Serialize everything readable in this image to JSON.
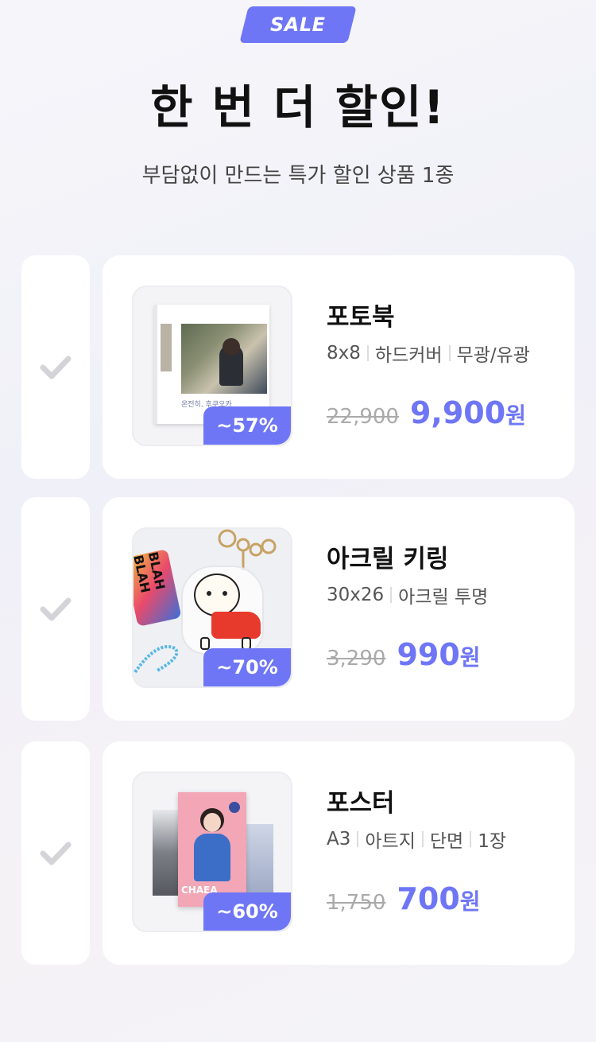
{
  "badge": "SALE",
  "headline": "한 번 더 할인!",
  "subline": "부담없이 만드는 특가 할인 상품 1종",
  "products": [
    {
      "name": "포토북",
      "specs": [
        "8x8",
        "하드커버",
        "무광/유광"
      ],
      "discount": "~57%",
      "original_price": "22,900",
      "sale_price": "9,900",
      "currency": "원",
      "thumb_caption": "온전히, 후쿠오카"
    },
    {
      "name": "아크릴 키링",
      "specs": [
        "30x26",
        "아크릴 투명"
      ],
      "discount": "~70%",
      "original_price": "3,290",
      "sale_price": "990",
      "currency": "원",
      "thumb_text": "BLAH BLAH"
    },
    {
      "name": "포스터",
      "specs": [
        "A3",
        "아트지",
        "단면",
        "1장"
      ],
      "discount": "~60%",
      "original_price": "1,750",
      "sale_price": "700",
      "currency": "원",
      "thumb_text": "CHAEA"
    }
  ],
  "colors": {
    "accent": "#6e76f6",
    "check": "#d4d4d8"
  },
  "icons": {
    "check": "checkmark-icon"
  }
}
